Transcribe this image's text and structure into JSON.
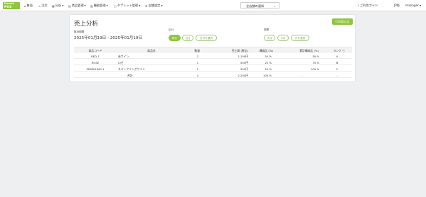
{
  "logo": {
    "line1": "Pocket",
    "line2": "POS"
  },
  "nav": [
    {
      "icon": "⌂",
      "label": "售面",
      "caret": false
    },
    {
      "icon": "≡",
      "label": "注文",
      "caret": false
    },
    {
      "icon": "▦",
      "label": "分析",
      "caret": true
    },
    {
      "icon": "▤",
      "label": "商品管理",
      "caret": true
    },
    {
      "icon": "▥",
      "label": "機能管理",
      "caret": true
    },
    {
      "icon": "▢",
      "label": "タブレット管理",
      "caret": true
    },
    {
      "icon": "⚙",
      "label": "店舗設定",
      "caret": true
    }
  ],
  "store_select": {
    "value": "全店舗の通知",
    "arrow": "⌄"
  },
  "header_right": {
    "guide": "ご利用ガイド",
    "lang": "JP版",
    "user": "manager"
  },
  "page": {
    "title": "売上分析",
    "csv_button": "CSV取込出",
    "period_label": "集計期間",
    "period_value": "2025年01月19日 - 2025年01月19日"
  },
  "filters": {
    "group1": {
      "label": "区分",
      "options": [
        {
          "label": "時分",
          "active": true
        },
        {
          "label": "当日",
          "active": false
        },
        {
          "label": "日付を選択",
          "active": false
        }
      ]
    },
    "group2": {
      "label": "期間",
      "options": [
        {
          "label": "先月",
          "active": false
        },
        {
          "label": "今月",
          "active": false
        },
        {
          "label": "月を選択",
          "active": false
        }
      ]
    }
  },
  "table": {
    "headers": [
      "商品コード",
      "商品名",
      "数量",
      "売上高 (税込)",
      "構成比 (%)",
      "累計構成比 (%)",
      "ランク ⓘ"
    ],
    "rows": [
      [
        "RED-1",
        "赤ワイン",
        "2",
        "1,100円",
        "50 %",
        "50 %",
        "A"
      ],
      [
        "ROSE",
        "ロゼ",
        "1",
        "550円",
        "25 %",
        "75 %",
        "B"
      ],
      [
        "SPARKLING-1",
        "スパークリングワイン",
        "1",
        "550円",
        "25 %",
        "100 %",
        "C"
      ],
      [
        "",
        "合計",
        "4",
        "2,200円",
        "100 %",
        "-",
        "-"
      ]
    ]
  }
}
